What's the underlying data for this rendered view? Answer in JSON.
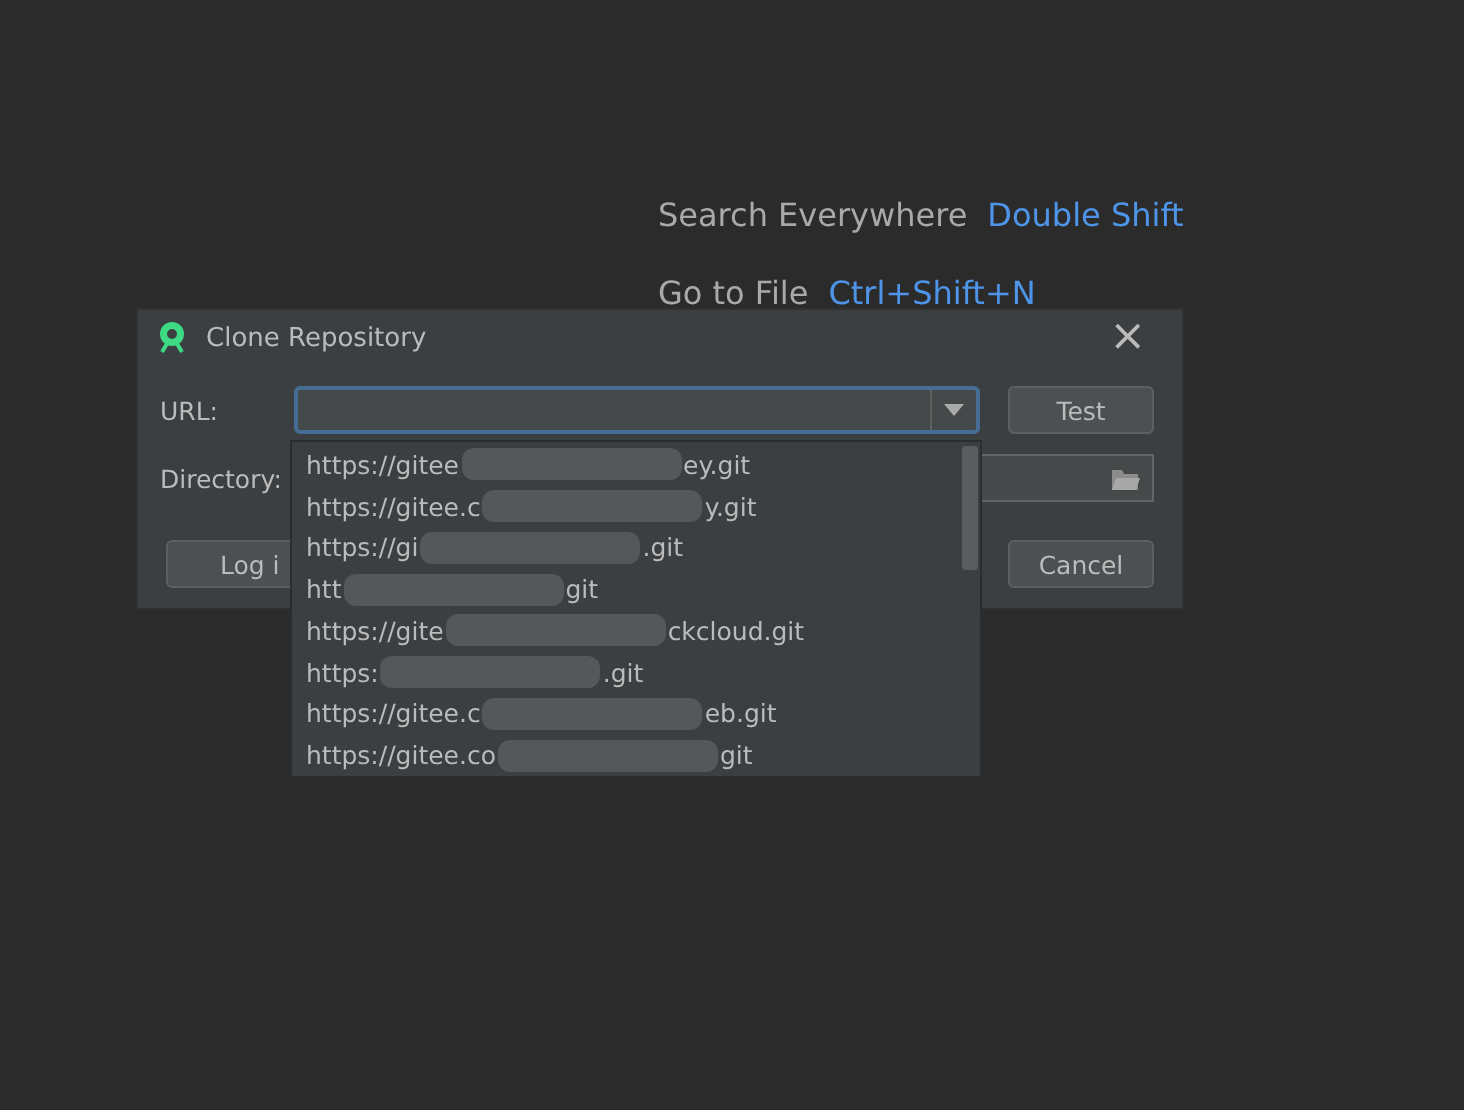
{
  "hints": [
    {
      "label": "Search Everywhere",
      "shortcut": "Double Shift"
    },
    {
      "label": "Go to File",
      "shortcut": "Ctrl+Shift+N"
    }
  ],
  "dialog": {
    "title": "Clone Repository",
    "close": "×",
    "url_label": "URL:",
    "test_button": "Test",
    "directory_label": "Directory:",
    "login_button": "Log i",
    "cancel_button": "Cancel"
  },
  "url_history": [
    {
      "start": "https://gitee",
      "end": "ey.git"
    },
    {
      "start": "https://gitee.c",
      "end": "y.git"
    },
    {
      "start": "https://gi",
      "end": ".git"
    },
    {
      "start": "htt",
      "end": "git"
    },
    {
      "start": "https://gite",
      "end": "ckcloud.git"
    },
    {
      "start": "https:",
      "end": ".git"
    },
    {
      "start": "https://gitee.c",
      "end": "eb.git"
    },
    {
      "start": "https://gitee.co",
      "end": "git"
    }
  ]
}
